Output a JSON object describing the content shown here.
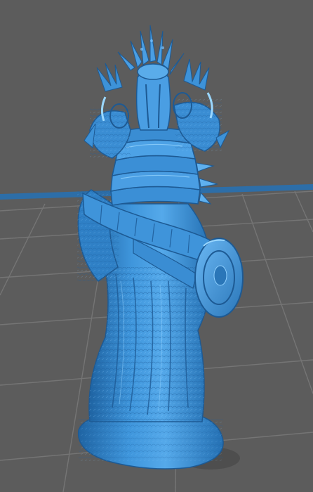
{
  "viewport": {
    "background_color": "#5c5c5c",
    "grid_color": "#777777",
    "bed_edge_color": "#2d6ea8",
    "model_color": "#3b8fd6",
    "model_highlight_color": "#7cc4ff",
    "model_shadow_color": "#1d5a94",
    "shadow_color": "#444444"
  }
}
